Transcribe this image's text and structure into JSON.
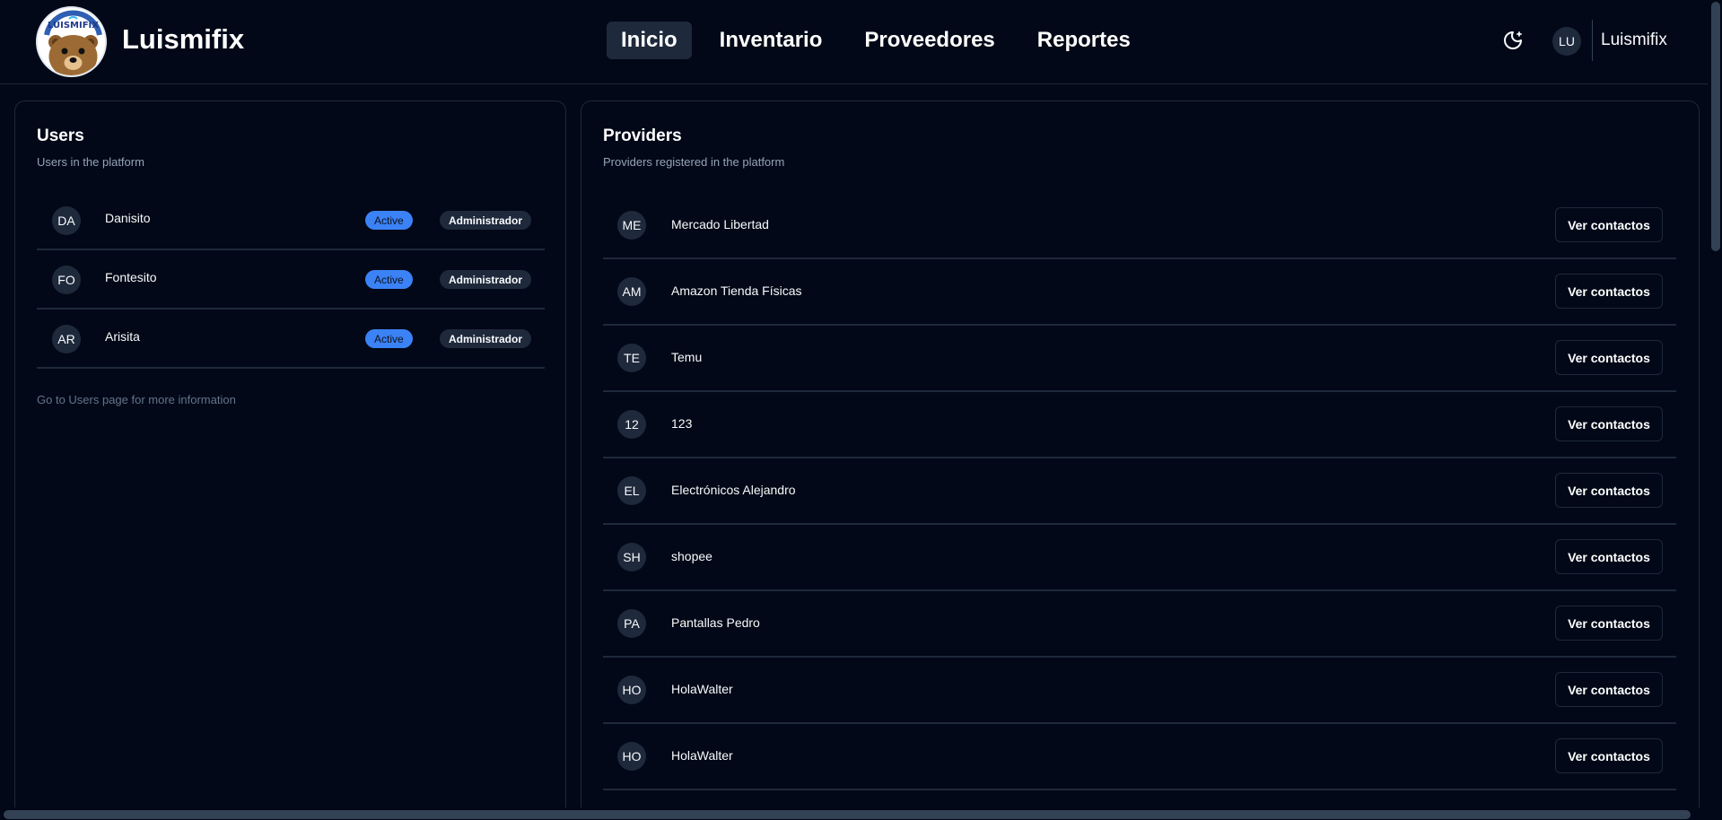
{
  "header": {
    "brand": "Luismifix",
    "logo_text": "LUISMIFIX",
    "nav": [
      {
        "label": "Inicio",
        "active": true
      },
      {
        "label": "Inventario",
        "active": false
      },
      {
        "label": "Proveedores",
        "active": false
      },
      {
        "label": "Reportes",
        "active": false
      }
    ],
    "theme_icon": "moon-icon",
    "user_initials": "LU",
    "user_name": "Luismifix"
  },
  "users": {
    "title": "Users",
    "subtitle": "Users in the platform",
    "rows": [
      {
        "initials": "DA",
        "name": "Danisito",
        "status": "Active",
        "role": "Administrador"
      },
      {
        "initials": "FO",
        "name": "Fontesito",
        "status": "Active",
        "role": "Administrador"
      },
      {
        "initials": "AR",
        "name": "Arisita",
        "status": "Active",
        "role": "Administrador"
      }
    ],
    "footer": "Go to Users page for more information"
  },
  "providers": {
    "title": "Providers",
    "subtitle": "Providers registered in the platform",
    "button_label": "Ver contactos",
    "rows": [
      {
        "initials": "ME",
        "name": "Mercado Libertad"
      },
      {
        "initials": "AM",
        "name": "Amazon Tienda Físicas"
      },
      {
        "initials": "TE",
        "name": "Temu"
      },
      {
        "initials": "12",
        "name": "123"
      },
      {
        "initials": "EL",
        "name": "Electrónicos Alejandro"
      },
      {
        "initials": "SH",
        "name": "shopee"
      },
      {
        "initials": "PA",
        "name": "Pantallas Pedro"
      },
      {
        "initials": "HO",
        "name": "HolaWalter"
      },
      {
        "initials": "HO",
        "name": "HolaWalter"
      }
    ]
  },
  "colors": {
    "background": "#020817",
    "border": "#1e293b",
    "accent": "#3b82f6"
  }
}
